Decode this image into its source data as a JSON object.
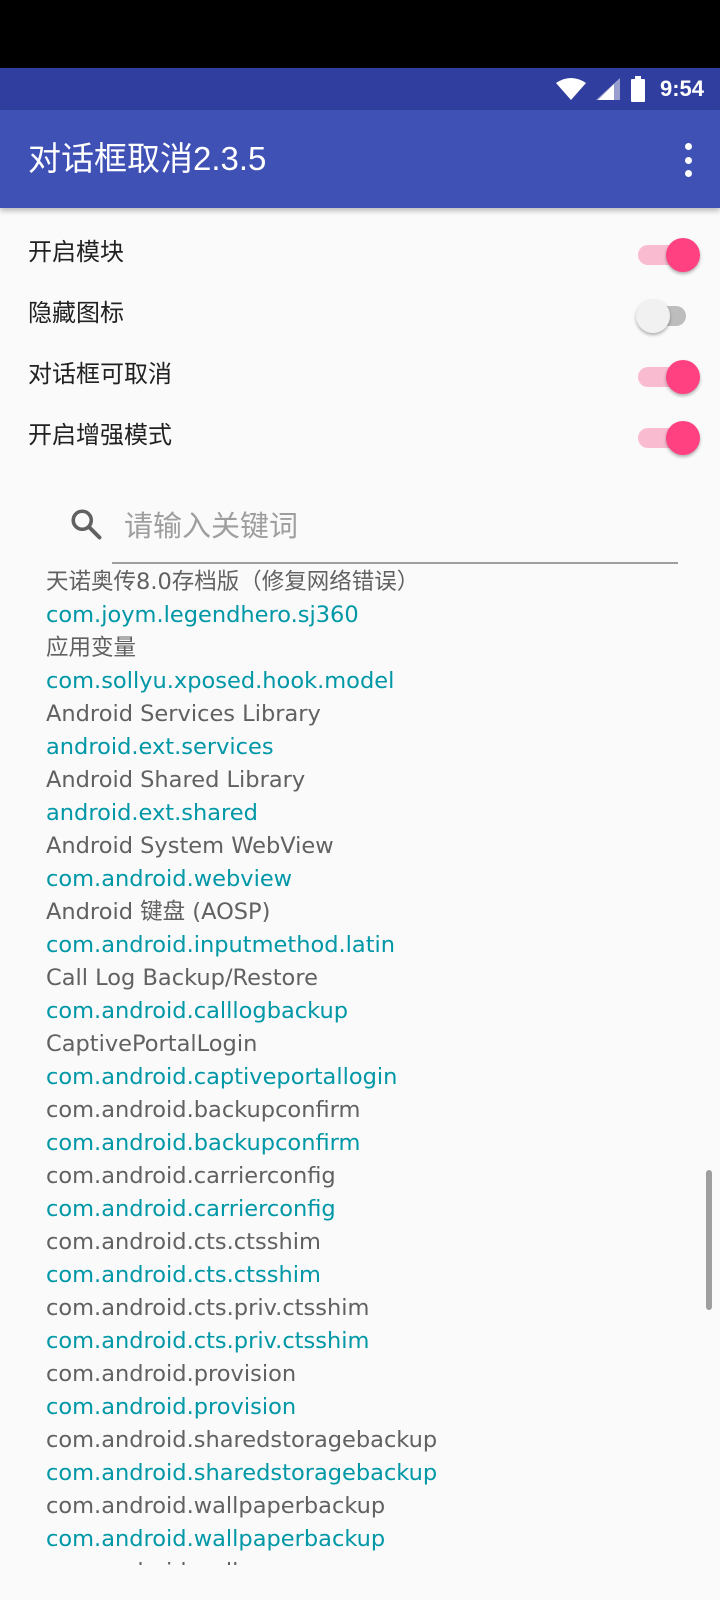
{
  "status_bar": {
    "time": "9:54"
  },
  "app_bar": {
    "title": "对话框取消2.3.5"
  },
  "settings": [
    {
      "label": "开启模块",
      "enabled": true
    },
    {
      "label": "隐藏图标",
      "enabled": false
    },
    {
      "label": "对话框可取消",
      "enabled": true
    },
    {
      "label": "开启增强模式",
      "enabled": true
    }
  ],
  "search": {
    "placeholder": "请输入关键词",
    "value": ""
  },
  "apps": [
    {
      "name": "天诺奥传8.0存档版（修复网络错误）",
      "package": "com.joym.legendhero.sj360"
    },
    {
      "name": "应用变量",
      "package": "com.sollyu.xposed.hook.model"
    },
    {
      "name": "Android Services Library",
      "package": "android.ext.services"
    },
    {
      "name": "Android Shared Library",
      "package": "android.ext.shared"
    },
    {
      "name": "Android System WebView",
      "package": "com.android.webview"
    },
    {
      "name": "Android 键盘 (AOSP)",
      "package": "com.android.inputmethod.latin"
    },
    {
      "name": "Call Log Backup/Restore",
      "package": "com.android.calllogbackup"
    },
    {
      "name": "CaptivePortalLogin",
      "package": "com.android.captiveportallogin"
    },
    {
      "name": "com.android.backupconfirm",
      "package": "com.android.backupconfirm"
    },
    {
      "name": "com.android.carrierconfig",
      "package": "com.android.carrierconfig"
    },
    {
      "name": "com.android.cts.ctsshim",
      "package": "com.android.cts.ctsshim"
    },
    {
      "name": "com.android.cts.priv.ctsshim",
      "package": "com.android.cts.priv.ctsshim"
    },
    {
      "name": "com.android.provision",
      "package": "com.android.provision"
    },
    {
      "name": "com.android.sharedstoragebackup",
      "package": "com.android.sharedstoragebackup"
    },
    {
      "name": "com.android.wallpaperbackup",
      "package": "com.android.wallpaperbackup"
    },
    {
      "name": "com.android.wallpapercropper",
      "package": ""
    }
  ],
  "colors": {
    "primary": "#3f51b5",
    "primary_dark": "#303f9f",
    "accent": "#ff4081",
    "package_text": "#0097a7"
  }
}
